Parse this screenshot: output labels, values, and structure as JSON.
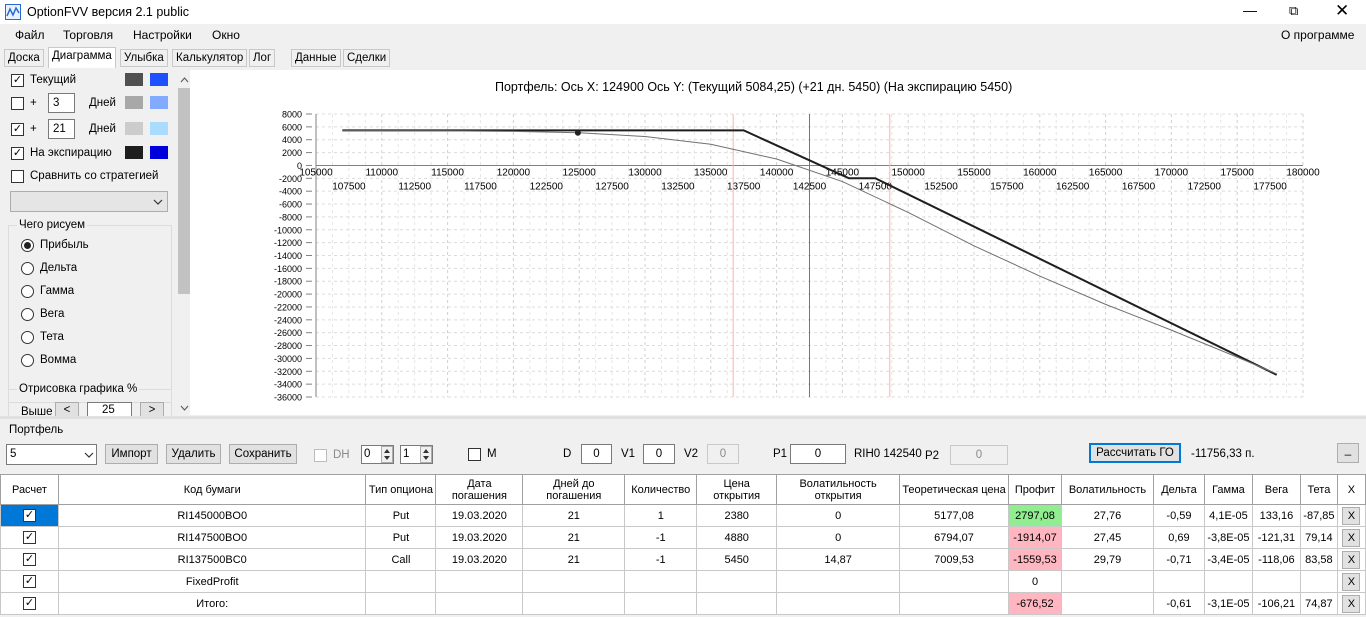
{
  "app": {
    "title": "OptionFVV версия 2.1 public"
  },
  "menu": {
    "items": [
      "Файл",
      "Торговля",
      "Настройки",
      "Окно"
    ],
    "about": "О программе"
  },
  "tabs": [
    "Доска",
    "Диаграмма",
    "Улыбка",
    "Калькулятор",
    "Лог",
    "Данные",
    "Сделки"
  ],
  "left_panel": {
    "current_label": "Текущий",
    "plus": "+",
    "days_label": "Дней",
    "days1": "3",
    "days2": "21",
    "expiry_label": "На экспирацию",
    "compare_label": "Сравнить со стратегией",
    "what_draw_title": "Чего рисуем",
    "radios": [
      "Прибыль",
      "Дельта",
      "Гамма",
      "Вега",
      "Тета",
      "Вомма"
    ],
    "render_title": "Отрисовка графика %",
    "above_label": "Выше",
    "above_value": "25",
    "prev": "<",
    "next": ">",
    "swatch_colors": {
      "current": [
        "#505050",
        "#1e50ff"
      ],
      "d3": [
        "#a8a8a8",
        "#82aaff"
      ],
      "d21": [
        "#cccccc",
        "#aadcff"
      ],
      "expiry": [
        "#1e1e1e",
        "#0000dc"
      ]
    }
  },
  "chart_data": {
    "type": "line",
    "title": "Портфель: Ось X: 124900 Ось Y:  (Текущий 5084,25)  (+21 дн. 5450)  (На экспирацию 5450)",
    "xlim": [
      105000,
      180000
    ],
    "ylim": [
      -36000,
      8000
    ],
    "x_ticks_top": [
      "105000",
      "110000",
      "115000",
      "120000",
      "125000",
      "130000",
      "135000",
      "140000",
      "145000",
      "150000",
      "155000",
      "160000",
      "165000",
      "170000",
      "175000",
      "180000"
    ],
    "x_ticks_bottom": [
      "107500",
      "112500",
      "117500",
      "122500",
      "127500",
      "132500",
      "137500",
      "142500",
      "147500",
      "152500",
      "157500",
      "162500",
      "167500",
      "172500",
      "177500"
    ],
    "y_ticks": [
      "8000",
      "6000",
      "4000",
      "2000",
      "0",
      "-2000",
      "-4000",
      "-6000",
      "-8000",
      "-10000",
      "-12000",
      "-14000",
      "-16000",
      "-18000",
      "-20000",
      "-22000",
      "-24000",
      "-26000",
      "-28000",
      "-30000",
      "-32000",
      "-34000",
      "-36000"
    ],
    "vlines": [
      {
        "x": 136700,
        "color": "#ffb0b0"
      },
      {
        "x": 142500,
        "color": "#777777"
      },
      {
        "x": 148600,
        "color": "#ffb0b0"
      }
    ],
    "series": [
      {
        "color": "#1e1e1e",
        "width": 2,
        "points": [
          [
            107000,
            5450
          ],
          [
            137500,
            5450
          ],
          [
            145500,
            -1990
          ],
          [
            147500,
            -1990
          ],
          [
            178000,
            -32550
          ]
        ]
      },
      {
        "color": "#707070",
        "width": 1,
        "points": [
          [
            107000,
            5400
          ],
          [
            115000,
            5380
          ],
          [
            120000,
            5300
          ],
          [
            125000,
            5084
          ],
          [
            130000,
            4500
          ],
          [
            135000,
            3300
          ],
          [
            140000,
            1000
          ],
          [
            145000,
            -2500
          ],
          [
            150000,
            -7300
          ],
          [
            155000,
            -12500
          ],
          [
            160000,
            -17200
          ],
          [
            165000,
            -21600
          ],
          [
            170000,
            -25600
          ],
          [
            175000,
            -29800
          ],
          [
            178000,
            -32400
          ]
        ]
      }
    ],
    "marker": {
      "x": 124900,
      "y": 5084
    }
  },
  "portfolio": {
    "title": "Портфель",
    "select_value": "5",
    "import": "Импорт",
    "delete": "Удалить",
    "save": "Сохранить",
    "dh": "DH",
    "spin1": "0",
    "spin2": "1",
    "m": "M",
    "d_label": "D",
    "d_val": "0",
    "v1_label": "V1",
    "v1_val": "0",
    "v2_label": "V2",
    "v2_val": "0",
    "p1_label": "P1",
    "p1_val": "0",
    "ticker": "RIH0 142540",
    "p2_label": "P2",
    "p2_val": "0",
    "calc_go": "Рассчитать ГО",
    "go_value": "-11756,33 п.",
    "minimize": "_"
  },
  "table": {
    "headers": [
      "Расчет",
      "Код бумаги",
      "Тип опциона",
      "Дата погашения",
      "Дней до погашения",
      "Количество",
      "Цена открытия",
      "Волатильность открытия",
      "Теоретическая цена",
      "Профит",
      "Волатильность",
      "Дельта",
      "Гамма",
      "Вега",
      "Тета",
      "X"
    ],
    "rows": [
      [
        "RI145000BO0",
        "Put",
        "19.03.2020",
        "21",
        "1",
        "2380",
        "0",
        "5177,08",
        "2797,08",
        "27,76",
        "-0,59",
        "4,1E-05",
        "133,16",
        "-87,85",
        "X"
      ],
      [
        "RI147500BO0",
        "Put",
        "19.03.2020",
        "21",
        "-1",
        "4880",
        "0",
        "6794,07",
        "-1914,07",
        "27,45",
        "0,69",
        "-3,8E-05",
        "-121,31",
        "79,14",
        "X"
      ],
      [
        "RI137500BC0",
        "Call",
        "19.03.2020",
        "21",
        "-1",
        "5450",
        "14,87",
        "7009,53",
        "-1559,53",
        "29,79",
        "-0,71",
        "-3,4E-05",
        "-118,06",
        "83,58",
        "X"
      ],
      [
        "FixedProfit",
        "",
        "",
        "",
        "",
        "",
        "",
        "",
        "0",
        "",
        "",
        "",
        "",
        "",
        "X"
      ],
      [
        "Итого:",
        "",
        "",
        "",
        "",
        "",
        "",
        "",
        "-676,52",
        "",
        "-0,61",
        "-3,1E-05",
        "-106,21",
        "74,87",
        "X"
      ]
    ]
  }
}
